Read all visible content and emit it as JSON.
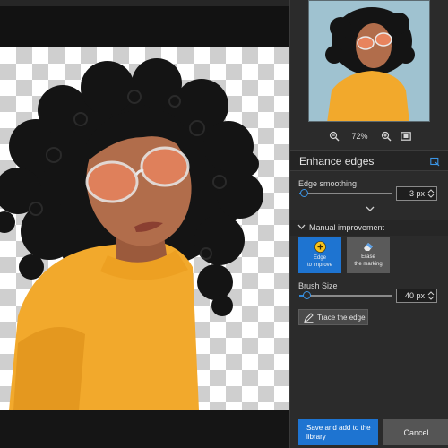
{
  "preview": {
    "zoom_out_icon": "zoom-out-icon",
    "zoom_level": "72%",
    "zoom_in_icon": "zoom-in-icon",
    "fit_icon": "fit-screen-icon"
  },
  "enhance_edges": {
    "title": "Enhance edges",
    "header_icon": "panel-options-icon",
    "edge_smoothing": {
      "label": "Edge smoothing",
      "value": "3 px",
      "level": 0.05
    }
  },
  "manual_improvement": {
    "title": "Manual improvement",
    "tools": [
      {
        "label": "Edge\nto improve",
        "icon": "plus-circle-icon",
        "active": true
      },
      {
        "label": "Erase\nthe marking",
        "icon": "eraser-icon",
        "active": false
      }
    ],
    "brush_size": {
      "label": "Brush Size",
      "value": "40 px",
      "level": 0.08
    },
    "trace_button": "Trace the edge"
  },
  "footer": {
    "save_label": "Save and add to the library",
    "cancel_label": "Cancel"
  },
  "colors": {
    "accent": "#1e74d1",
    "panel_bg": "#2b2b2b",
    "sweater": "#f2a92c",
    "lenses": "#e8845e",
    "preview_bg": "#9fc2d0"
  }
}
